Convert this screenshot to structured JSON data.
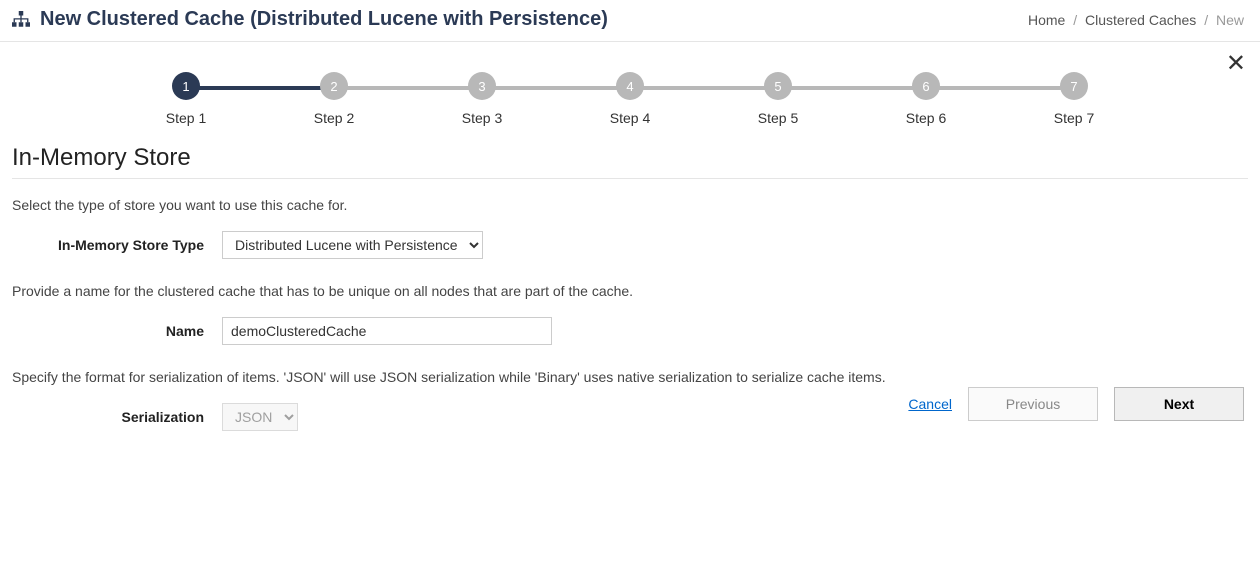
{
  "header": {
    "title": "New Clustered Cache (Distributed Lucene with Persistence)",
    "breadcrumb": {
      "home": "Home",
      "part1": "Clustered Caches",
      "current": "New"
    }
  },
  "stepper": {
    "steps": [
      {
        "num": "1",
        "label": "Step 1",
        "active": true
      },
      {
        "num": "2",
        "label": "Step 2",
        "active": false
      },
      {
        "num": "3",
        "label": "Step 3",
        "active": false
      },
      {
        "num": "4",
        "label": "Step 4",
        "active": false
      },
      {
        "num": "5",
        "label": "Step 5",
        "active": false
      },
      {
        "num": "6",
        "label": "Step 6",
        "active": false
      },
      {
        "num": "7",
        "label": "Step 7",
        "active": false
      }
    ]
  },
  "section": {
    "title": "In-Memory Store"
  },
  "form": {
    "help1": "Select the type of store you want to use this cache for.",
    "storeType": {
      "label": "In-Memory Store Type",
      "value": "Distributed Lucene with Persistence"
    },
    "help2": "Provide a name for the clustered cache that has to be unique on all nodes that are part of the cache.",
    "name": {
      "label": "Name",
      "value": "demoClusteredCache"
    },
    "help3": "Specify the format for serialization of items. 'JSON' will use JSON serialization while 'Binary' uses native serialization to serialize cache items.",
    "serialization": {
      "label": "Serialization",
      "value": "JSON"
    }
  },
  "footer": {
    "cancel": "Cancel",
    "previous": "Previous",
    "next": "Next"
  }
}
